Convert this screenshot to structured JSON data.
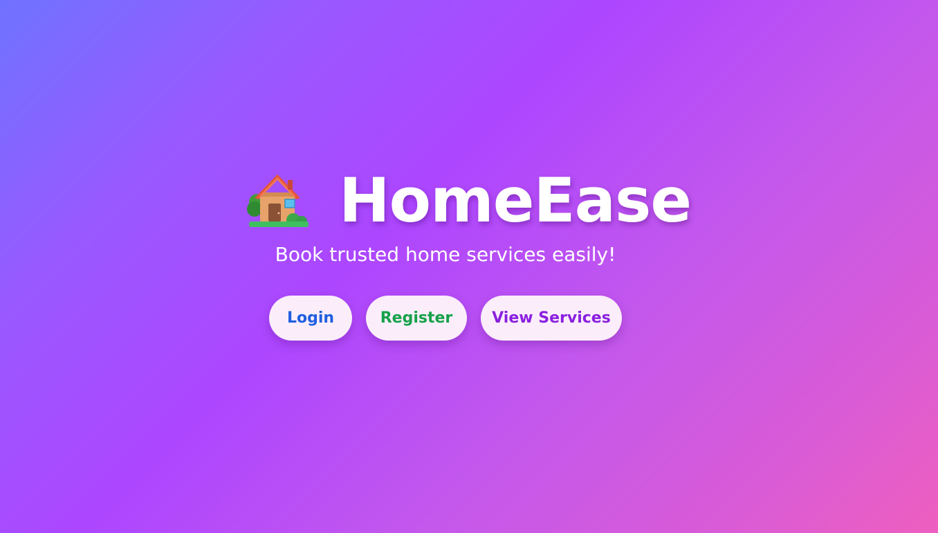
{
  "hero": {
    "icon": "house-icon",
    "title": "HomeEase",
    "subtitle": "Book trusted home services easily!"
  },
  "buttons": {
    "login": {
      "label": "Login",
      "color": "#1f5fe0"
    },
    "register": {
      "label": "Register",
      "color": "#16a14a"
    },
    "services": {
      "label": "View Services",
      "color": "#8a1fe0"
    }
  },
  "colors": {
    "button_bg": "#fbeefa",
    "gradient_start": "#6f73ff",
    "gradient_mid": "#ad46ff",
    "gradient_end": "#ee5fbf"
  }
}
